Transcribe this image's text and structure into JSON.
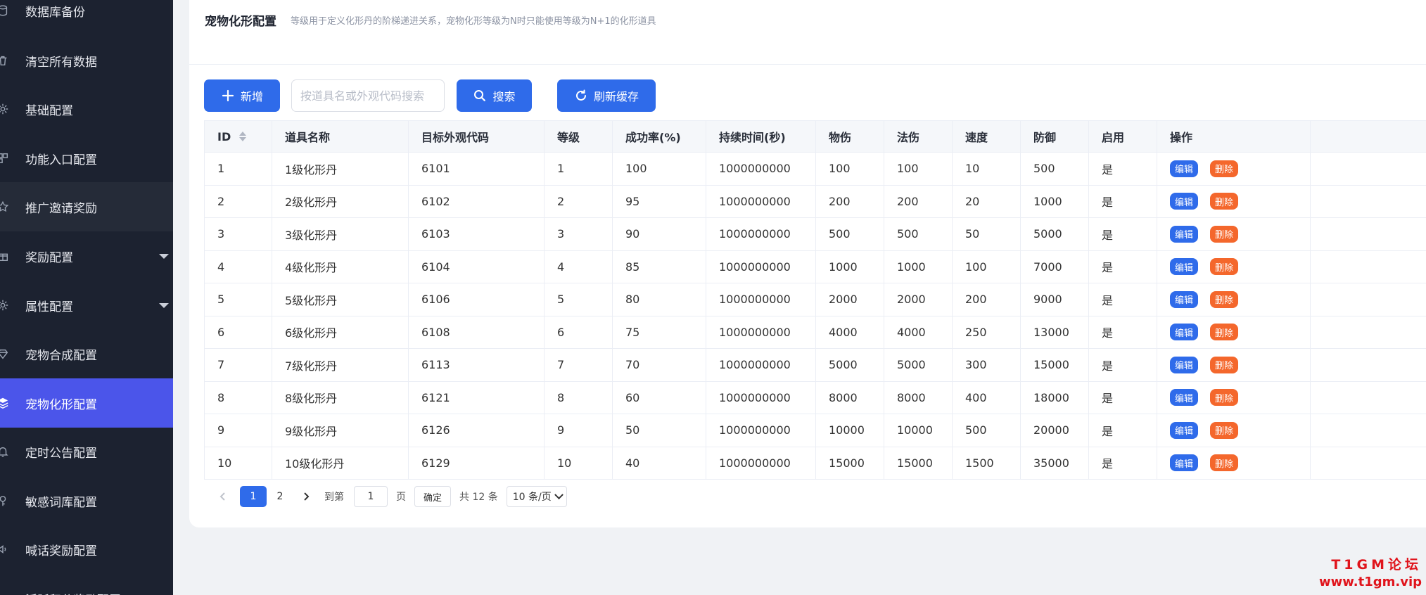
{
  "sidebar": {
    "items": [
      {
        "label": "数据库备份",
        "icon": "database-icon"
      },
      {
        "label": "清空所有数据",
        "icon": "trash-icon"
      },
      {
        "label": "基础配置",
        "icon": "gear-icon"
      },
      {
        "label": "功能入口配置",
        "icon": "grid-icon"
      },
      {
        "label": "推广邀请奖励",
        "icon": "star-icon"
      },
      {
        "label": "奖励配置",
        "icon": "gift-icon"
      },
      {
        "label": "属性配置",
        "icon": "gear-icon"
      },
      {
        "label": "宠物合成配置",
        "icon": "diamond-icon"
      },
      {
        "label": "宠物化形配置",
        "icon": "layers-icon"
      },
      {
        "label": "定时公告配置",
        "icon": "bell-icon"
      },
      {
        "label": "敏感词库配置",
        "icon": "key-icon"
      },
      {
        "label": "喊话奖励配置",
        "icon": "speaker-icon"
      },
      {
        "label": "活跃积分奖励配置",
        "icon": "gift-icon"
      }
    ]
  },
  "header": {
    "title": "宠物化形配置",
    "subtitle": "等级用于定义化形丹的阶梯递进关系，宠物化形等级为N时只能使用等级为N+1的化形道具"
  },
  "toolbar": {
    "add_label": "新增",
    "search_placeholder": "按道具名或外观代码搜索",
    "search_label": "搜索",
    "refresh_label": "刷新缓存"
  },
  "table": {
    "columns": [
      "ID",
      "道具名称",
      "目标外观代码",
      "等级",
      "成功率(%)",
      "持续时间(秒)",
      "物伤",
      "法伤",
      "速度",
      "防御",
      "启用",
      "操作"
    ],
    "rows": [
      [
        "1",
        "1级化形丹",
        "6101",
        "1",
        "100",
        "1000000000",
        "100",
        "100",
        "10",
        "500",
        "是"
      ],
      [
        "2",
        "2级化形丹",
        "6102",
        "2",
        "95",
        "1000000000",
        "200",
        "200",
        "20",
        "1000",
        "是"
      ],
      [
        "3",
        "3级化形丹",
        "6103",
        "3",
        "90",
        "1000000000",
        "500",
        "500",
        "50",
        "5000",
        "是"
      ],
      [
        "4",
        "4级化形丹",
        "6104",
        "4",
        "85",
        "1000000000",
        "1000",
        "1000",
        "100",
        "7000",
        "是"
      ],
      [
        "5",
        "5级化形丹",
        "6106",
        "5",
        "80",
        "1000000000",
        "2000",
        "2000",
        "200",
        "9000",
        "是"
      ],
      [
        "6",
        "6级化形丹",
        "6108",
        "6",
        "75",
        "1000000000",
        "4000",
        "4000",
        "250",
        "13000",
        "是"
      ],
      [
        "7",
        "7级化形丹",
        "6113",
        "7",
        "70",
        "1000000000",
        "5000",
        "5000",
        "300",
        "15000",
        "是"
      ],
      [
        "8",
        "8级化形丹",
        "6121",
        "8",
        "60",
        "1000000000",
        "8000",
        "8000",
        "400",
        "18000",
        "是"
      ],
      [
        "9",
        "9级化形丹",
        "6126",
        "9",
        "50",
        "1000000000",
        "10000",
        "10000",
        "500",
        "20000",
        "是"
      ],
      [
        "10",
        "10级化形丹",
        "6129",
        "10",
        "40",
        "1000000000",
        "15000",
        "15000",
        "1500",
        "35000",
        "是"
      ]
    ],
    "edit_label": "编辑",
    "delete_label": "删除"
  },
  "pagination": {
    "pages": [
      "1",
      "2"
    ],
    "current": "1",
    "goto_prefix": "到第",
    "goto_value": "1",
    "goto_suffix": "页",
    "confirm_label": "确定",
    "total_text": "共 12 条",
    "page_size": "10 条/页"
  },
  "watermark": {
    "line1": "T1GM论坛",
    "line2": "www.t1gm.vip"
  },
  "colors": {
    "primary": "#2f6bea",
    "danger": "#f4672c",
    "sidebar_bg": "#1c2230",
    "sidebar_active": "#4b55ea",
    "watermark": "#e0141c"
  }
}
